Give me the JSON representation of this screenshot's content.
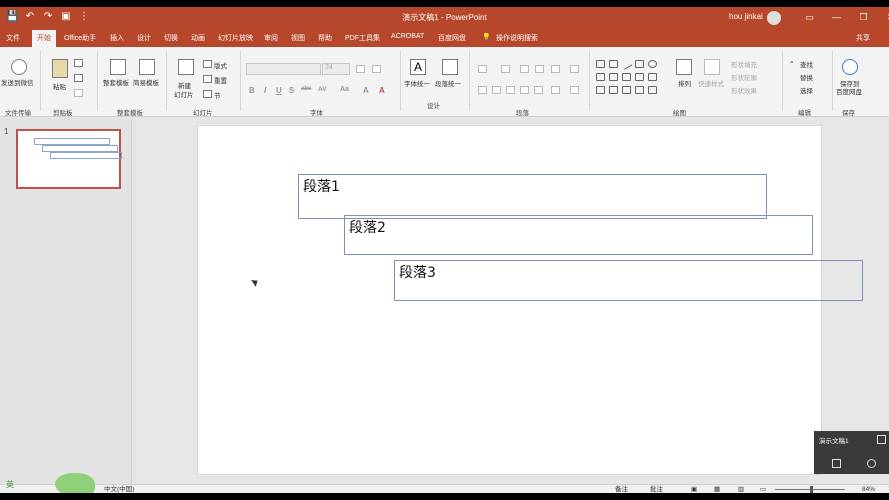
{
  "window": {
    "title": "演示文稿1 - PowerPoint",
    "user": "hou jinkai",
    "controls": [
      "▭",
      "—",
      "❐",
      "✕"
    ]
  },
  "qat": [
    "💾",
    "↶",
    "↷",
    "▣",
    "⋮"
  ],
  "tabs": [
    {
      "label": "文件"
    },
    {
      "label": "开始"
    },
    {
      "label": "Office助手"
    },
    {
      "label": "插入"
    },
    {
      "label": "设计"
    },
    {
      "label": "切换"
    },
    {
      "label": "动画"
    },
    {
      "label": "幻灯片放映"
    },
    {
      "label": "审阅"
    },
    {
      "label": "视图"
    },
    {
      "label": "帮助"
    },
    {
      "label": "PDF工具集"
    },
    {
      "label": "ACROBAT"
    },
    {
      "label": "百度网盘"
    },
    {
      "label": "操作说明搜索"
    }
  ],
  "share_label": "共享",
  "ribbon": {
    "send_wechat": "发送到微信",
    "file_transfer": "文件传输",
    "paste": "粘贴",
    "clipboard": "剪贴板",
    "templates_1": "整套模板",
    "templates_2": "简易模板",
    "templates_group": "整套模板",
    "new_slide": "新建",
    "new_slide_2": "幻灯片",
    "layout": "版式",
    "reset": "重置",
    "section": "节",
    "slides_group": "幻灯片",
    "font_size": "24",
    "font_group": "字体",
    "format_btns": [
      "B",
      "I",
      "U",
      "S",
      "abc",
      "AV",
      "Aa",
      "A"
    ],
    "font_unify": "字体统一",
    "paragraph_unify": "段落统一",
    "design_group": "设计",
    "paragraph_group": "段落",
    "arrange": "排列",
    "quick_styles": "快速样式",
    "shape_fill": "形状填充",
    "shape_outline": "形状轮廓",
    "shape_effects": "形状效果",
    "drawing_group": "绘图",
    "find": "查找",
    "replace": "替换",
    "select": "选择",
    "editing_group": "编辑",
    "save_baidu_1": "保存到",
    "save_baidu_2": "百度网盘",
    "save_group": "保存"
  },
  "thumbnails": {
    "slide_number": "1"
  },
  "slide": {
    "paragraph_1": "段落1",
    "paragraph_2": "段落2",
    "paragraph_3": "段落3"
  },
  "popup": {
    "title": "演示文稿1"
  },
  "statusbar": {
    "language": "中文(中国)",
    "notes": "备注",
    "comments": "批注",
    "zoom": "84%"
  },
  "taskbar": {
    "ime": "英"
  },
  "colors": {
    "accent": "#b7472a",
    "ribbon_bg": "#f3f3f3",
    "selection": "#c0504d",
    "textbox_border": "#7f8fb7"
  }
}
